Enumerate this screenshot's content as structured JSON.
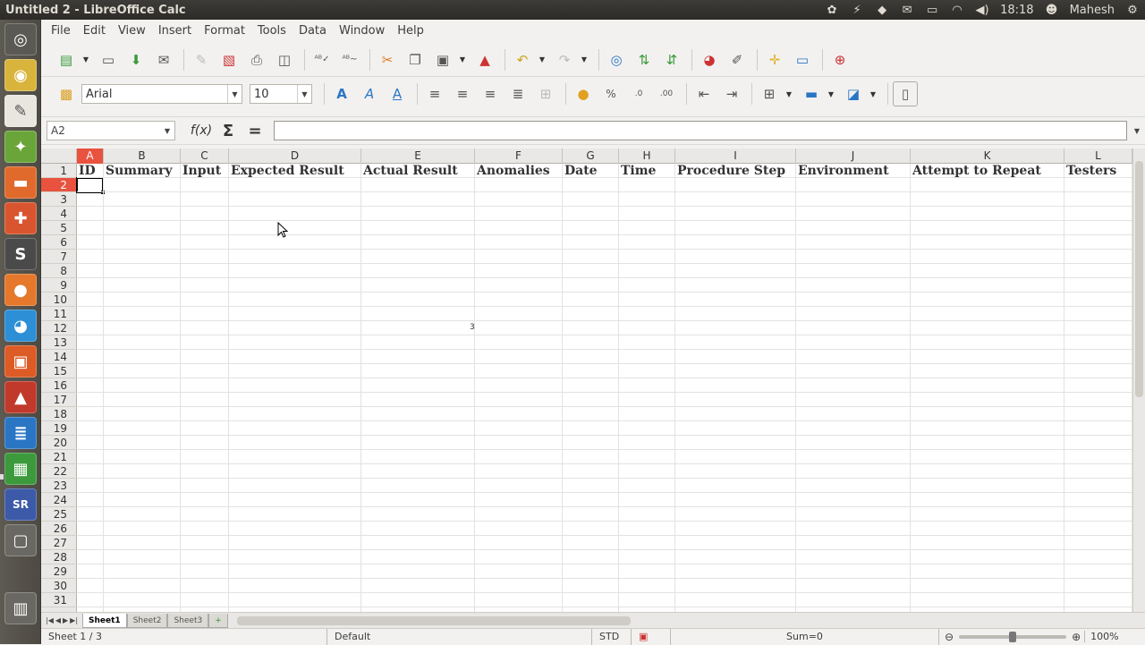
{
  "window": {
    "title": "Untitled 2 - LibreOffice Calc"
  },
  "tray": {
    "time": "18:18",
    "user": "Mahesh"
  },
  "menu": [
    {
      "label": "File",
      "access_key": "F"
    },
    {
      "label": "Edit",
      "access_key": "E"
    },
    {
      "label": "View",
      "access_key": "V"
    },
    {
      "label": "Insert",
      "access_key": "I"
    },
    {
      "label": "Format",
      "access_key": "o"
    },
    {
      "label": "Tools",
      "access_key": "T"
    },
    {
      "label": "Data",
      "access_key": "D"
    },
    {
      "label": "Window",
      "access_key": "W"
    },
    {
      "label": "Help",
      "access_key": "H"
    }
  ],
  "formatting": {
    "font_name": "Arial",
    "font_size": "10"
  },
  "formula_bar": {
    "name_box": "A2",
    "content": ""
  },
  "columns": [
    "A",
    "B",
    "C",
    "D",
    "E",
    "F",
    "G",
    "H",
    "I",
    "J",
    "K",
    "L"
  ],
  "header_row": [
    "ID",
    "Summary",
    "Input",
    "Expected Result",
    "Actual Result",
    "Anomalies",
    "Date",
    "Time",
    "Procedure Step",
    "Environment",
    "Attempt to Repeat",
    "Testers"
  ],
  "selection": {
    "cell": "A2",
    "column": "A",
    "row": 2
  },
  "stray_value": "3",
  "sheet_tabs": [
    {
      "label": "Sheet1",
      "active": true
    },
    {
      "label": "Sheet2",
      "active": false
    },
    {
      "label": "Sheet3",
      "active": false
    }
  ],
  "status": {
    "sheet": "Sheet 1 / 3",
    "page_style": "Default",
    "mode": "STD",
    "sum": "Sum=0",
    "zoom": "100%"
  },
  "colors": {
    "selected_header": "#e8523f",
    "topbar": "#3d3c38",
    "launcher": "#5d5a52"
  }
}
